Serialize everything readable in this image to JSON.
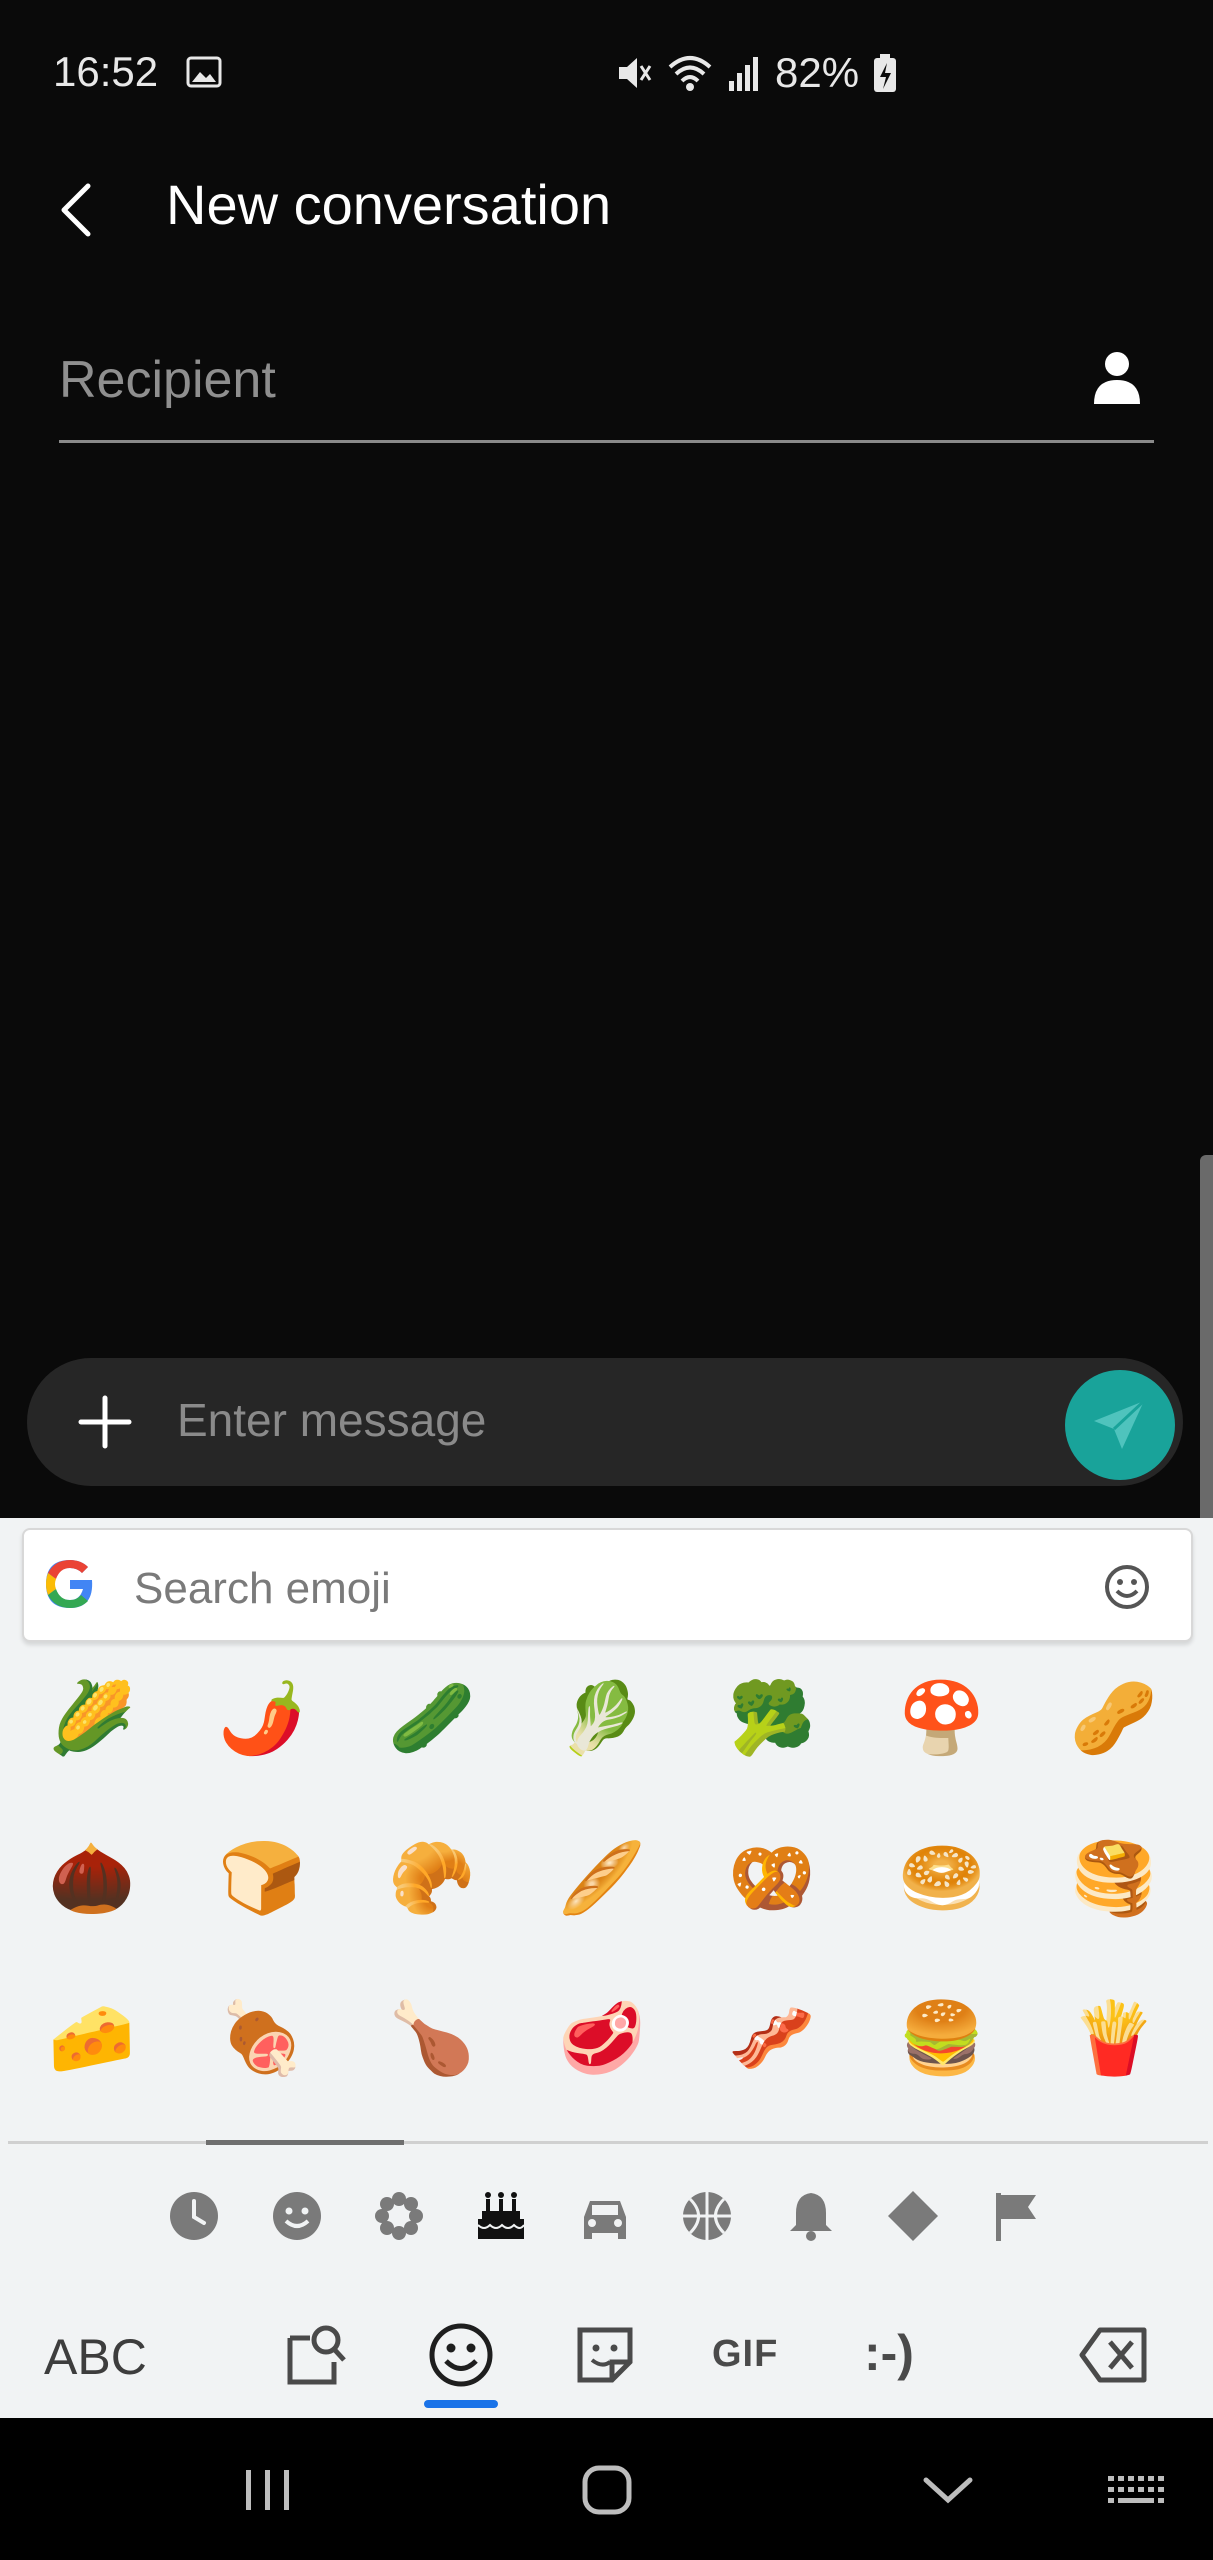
{
  "status_bar": {
    "time": "16:52",
    "battery": "82%"
  },
  "app_bar": {
    "title": "New conversation"
  },
  "recipient": {
    "placeholder": "Recipient"
  },
  "composer": {
    "placeholder": "Enter message"
  },
  "emoji_keyboard": {
    "search_placeholder": "Search emoji",
    "rows": [
      [
        "🌽",
        "🌶️",
        "🥒",
        "🥬",
        "🥦",
        "🍄",
        "🥜"
      ],
      [
        "🌰",
        "🍞",
        "🥐",
        "🥖",
        "🥨",
        "🥯",
        "🥞"
      ],
      [
        "🧀",
        "🍖",
        "🍗",
        "🥩",
        "🥓",
        "🍔",
        "🍟"
      ]
    ],
    "categories": [
      "recent-icon",
      "smileys-icon",
      "nature-icon",
      "food-icon",
      "travel-icon",
      "activities-icon",
      "objects-icon",
      "symbols-icon",
      "flags-icon"
    ],
    "bottom": {
      "abc": "ABC",
      "gif": "GIF",
      "emoticon": ":-)"
    }
  },
  "colors": {
    "accent": "#19a39a",
    "kb_accent": "#1a73e8"
  }
}
